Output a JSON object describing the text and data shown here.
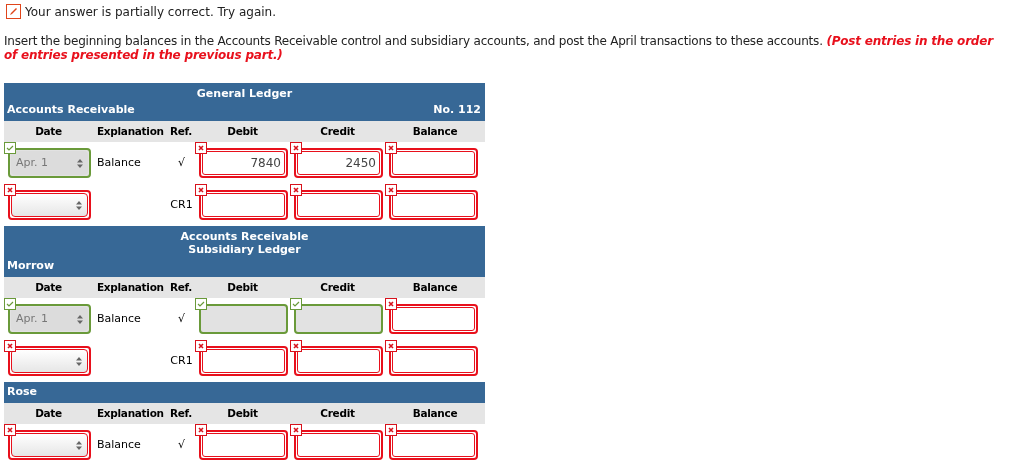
{
  "feedback": {
    "text": "Your answer is partially correct.  Try again."
  },
  "instructions": {
    "text": "Insert the beginning balances in the Accounts Receivable control and subsidiary accounts, and post the April transactions to these accounts. ",
    "note": "(Post entries in the order of entries presented in the previous part.)"
  },
  "sections": [
    {
      "title": "General Ledger",
      "accounts": [
        {
          "name": "Accounts Receivable",
          "number": "No. 112",
          "columns": [
            "Date",
            "Explanation",
            "Ref.",
            "Debit",
            "Credit",
            "Balance"
          ],
          "rows": [
            {
              "date": {
                "value": "Apr. 1",
                "correct": true
              },
              "explanation": "Balance",
              "ref": "√",
              "debit": {
                "value": "7840",
                "correct": false
              },
              "credit": {
                "value": "2450",
                "correct": false
              },
              "balance": {
                "correct": false
              }
            },
            {
              "date": {
                "correct": false
              },
              "ref": "CR1",
              "debit": {
                "correct": false
              },
              "credit": {
                "correct": false
              },
              "balance": {
                "correct": false
              }
            }
          ]
        }
      ]
    },
    {
      "title": "Accounts Receivable\nSubsidiary Ledger",
      "accounts": [
        {
          "name": "Morrow",
          "columns": [
            "Date",
            "Explanation",
            "Ref.",
            "Debit",
            "Credit",
            "Balance"
          ],
          "rows": [
            {
              "date": {
                "value": "Apr. 1",
                "correct": true
              },
              "explanation": "Balance",
              "ref": "√",
              "debit": {
                "correct": true
              },
              "credit": {
                "correct": true
              },
              "balance": {
                "correct": false
              }
            },
            {
              "date": {
                "correct": false
              },
              "ref": "CR1",
              "debit": {
                "correct": false
              },
              "credit": {
                "correct": false
              },
              "balance": {
                "correct": false
              }
            }
          ]
        },
        {
          "name": "Rose",
          "columns": [
            "Date",
            "Explanation",
            "Ref.",
            "Debit",
            "Credit",
            "Balance"
          ],
          "rows": [
            {
              "date": {
                "correct": false
              },
              "explanation": "Balance",
              "ref": "√",
              "debit": {
                "correct": false
              },
              "credit": {
                "correct": false
              },
              "balance": {
                "correct": false
              }
            }
          ]
        }
      ]
    }
  ]
}
